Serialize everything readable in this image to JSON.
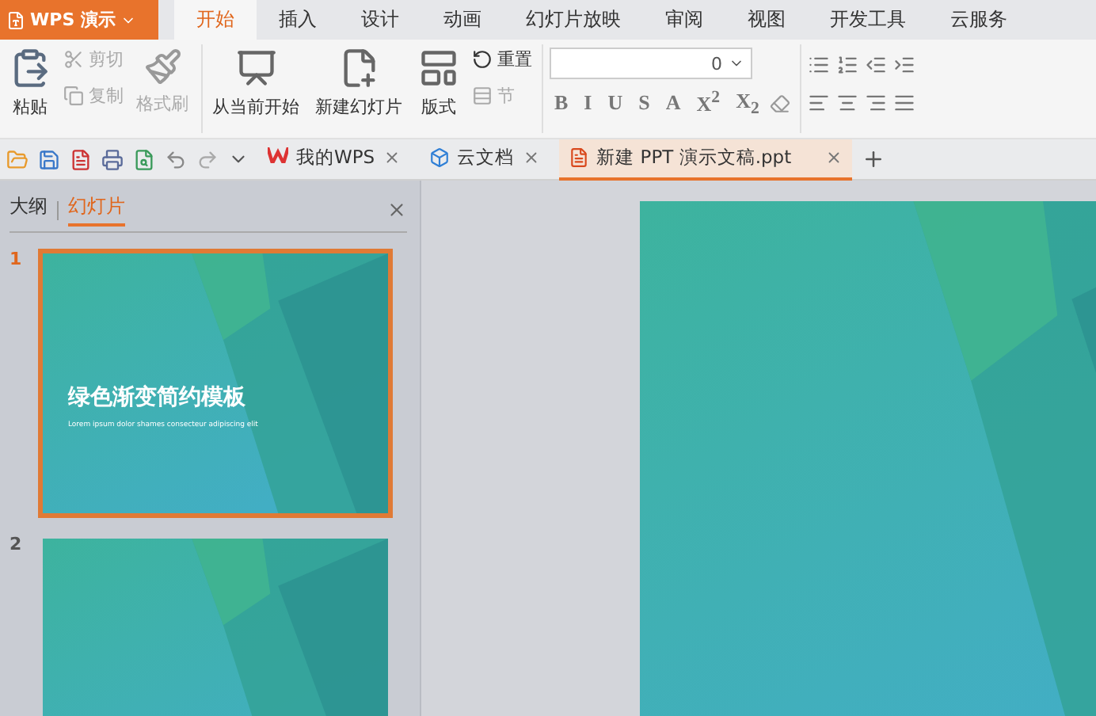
{
  "app_menu": {
    "label": "WPS 演示"
  },
  "ribbon_tabs": [
    {
      "label": "开始",
      "selected": true
    },
    {
      "label": "插入",
      "selected": false
    },
    {
      "label": "设计",
      "selected": false
    },
    {
      "label": "动画",
      "selected": false
    },
    {
      "label": "幻灯片放映",
      "selected": false
    },
    {
      "label": "审阅",
      "selected": false
    },
    {
      "label": "视图",
      "selected": false
    },
    {
      "label": "开发工具",
      "selected": false
    },
    {
      "label": "云服务",
      "selected": false
    }
  ],
  "clipboard": {
    "paste": "粘贴",
    "small": [
      {
        "label": "剪切",
        "kind": "cut",
        "disabled": true
      },
      {
        "label": "复制",
        "kind": "copy",
        "disabled": true
      }
    ],
    "format_painter": {
      "label": "格式刷",
      "disabled": true
    }
  },
  "slides_group": {
    "big": [
      {
        "label": "从当前开始",
        "kind": "play"
      },
      {
        "label": "新建幻灯片",
        "kind": "new"
      },
      {
        "label": "版式",
        "kind": "layout"
      }
    ],
    "small": [
      {
        "label": "重置",
        "disabled": false
      },
      {
        "label": "节",
        "disabled": true
      }
    ]
  },
  "font": {
    "size": "0",
    "styles": [
      "B",
      "I",
      "U",
      "S",
      "A",
      "X$^{2}$",
      "X$_{2}$"
    ]
  },
  "doc_tabs": [
    {
      "label": "我的WPS",
      "kind": "wps",
      "selected": false
    },
    {
      "label": "云文档",
      "kind": "cloud",
      "selected": false
    },
    {
      "label": "新建 PPT 演示文稿.ppt",
      "kind": "ppt",
      "selected": true
    }
  ],
  "side_tabs": [
    {
      "label": "大纲",
      "selected": false
    },
    {
      "label": "幻灯片",
      "selected": true
    }
  ],
  "slides": [
    {
      "number": "1",
      "selected": true,
      "title": "绿色渐变简约模板",
      "subtitle": "Lorem ipsum dolor shames consecteur adipiscing elit"
    },
    {
      "number": "2",
      "selected": false
    }
  ]
}
